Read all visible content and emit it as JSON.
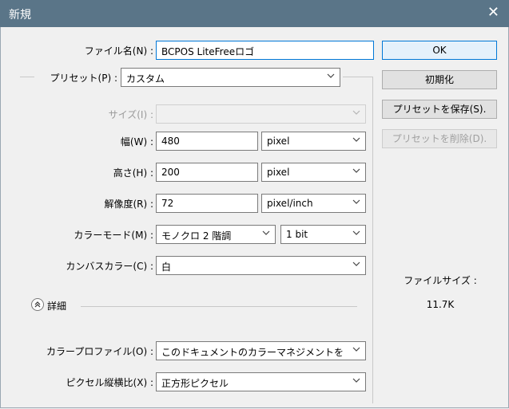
{
  "window": {
    "title": "新規",
    "close_glyph": "✕"
  },
  "fields": {
    "name": {
      "label": "ファイル名(N) :",
      "value": "BCPOS LiteFreeロゴ"
    },
    "preset": {
      "label": "プリセット(P) :",
      "value": "カスタム"
    },
    "size": {
      "label": "サイズ(I) :",
      "value": ""
    },
    "width": {
      "label": "幅(W) :",
      "value": "480",
      "unit": "pixel"
    },
    "height": {
      "label": "高さ(H) :",
      "value": "200",
      "unit": "pixel"
    },
    "resolution": {
      "label": "解像度(R) :",
      "value": "72",
      "unit": "pixel/inch"
    },
    "color_mode": {
      "label": "カラーモード(M) :",
      "value": "モノクロ 2 階調",
      "depth": "1 bit"
    },
    "canvas_color": {
      "label": "カンバスカラー(C) :",
      "value": "白"
    },
    "color_profile": {
      "label": "カラープロファイル(O) :",
      "value": "このドキュメントのカラーマネジメントを"
    },
    "pixel_aspect": {
      "label": "ピクセル縦横比(X) :",
      "value": "正方形ピクセル"
    }
  },
  "details": {
    "label": "詳細"
  },
  "buttons": {
    "ok": "OK",
    "reset": "初期化",
    "save_preset": "プリセットを保存(S).",
    "delete_preset": "プリセットを削除(D)."
  },
  "file_size": {
    "label": "ファイルサイズ :",
    "value": "11.7K"
  },
  "icons": {
    "chevron": "chevron-down-icon",
    "details_toggle": "chevron-up-circle-icon"
  }
}
